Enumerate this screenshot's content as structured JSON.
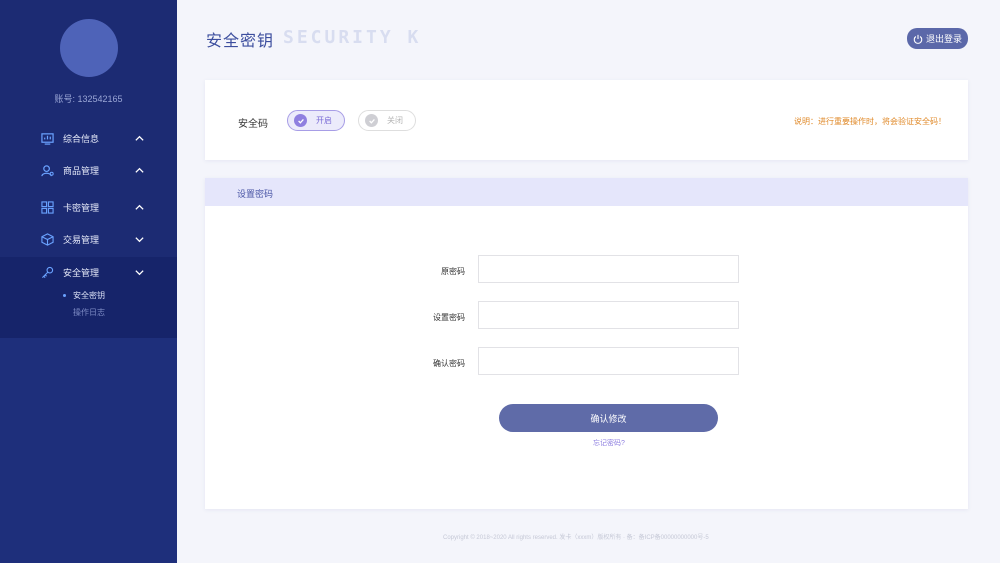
{
  "sidebar": {
    "account_text": "账号:  132542165",
    "items": [
      {
        "label": "综合信息",
        "icon": "dashboard-icon",
        "expanded": false
      },
      {
        "label": "商品管理",
        "icon": "user-goods-icon",
        "expanded": false
      },
      {
        "label": "卡密管理",
        "icon": "grid-icon",
        "expanded": false
      },
      {
        "label": "交易管理",
        "icon": "box-icon",
        "expanded": true
      },
      {
        "label": "安全管理",
        "icon": "key-icon",
        "expanded": true
      }
    ],
    "sub_items": [
      {
        "label": "安全密钥",
        "active": true
      },
      {
        "label": "操作日志",
        "active": false
      }
    ]
  },
  "header": {
    "title": "安全密钥",
    "title_deco": "SECURITY K",
    "logout_label": "退出登录"
  },
  "security_code": {
    "label": "安全码",
    "on_label": "开启",
    "off_label": "关闭",
    "selected": "开启",
    "note": "说明：进行重要操作时，将会验证安全码！"
  },
  "password_form": {
    "section_title": "设置密码",
    "fields": [
      {
        "label": "原密码",
        "value": ""
      },
      {
        "label": "设置密码",
        "value": ""
      },
      {
        "label": "确认密码",
        "value": ""
      }
    ],
    "submit_label": "确认修改",
    "forgot_label": "忘记密码?"
  },
  "footer": {
    "text": "Copyright © 2018~2020 All rights reserved. 发卡（xxxm）版权所有 · 备：备ICP备00000000000号-5"
  },
  "colors": {
    "sidebar_bg": "#1e2f7b",
    "accent": "#5b68a9",
    "toggle_on": "#8f7fe0",
    "note": "#e08a2a"
  }
}
